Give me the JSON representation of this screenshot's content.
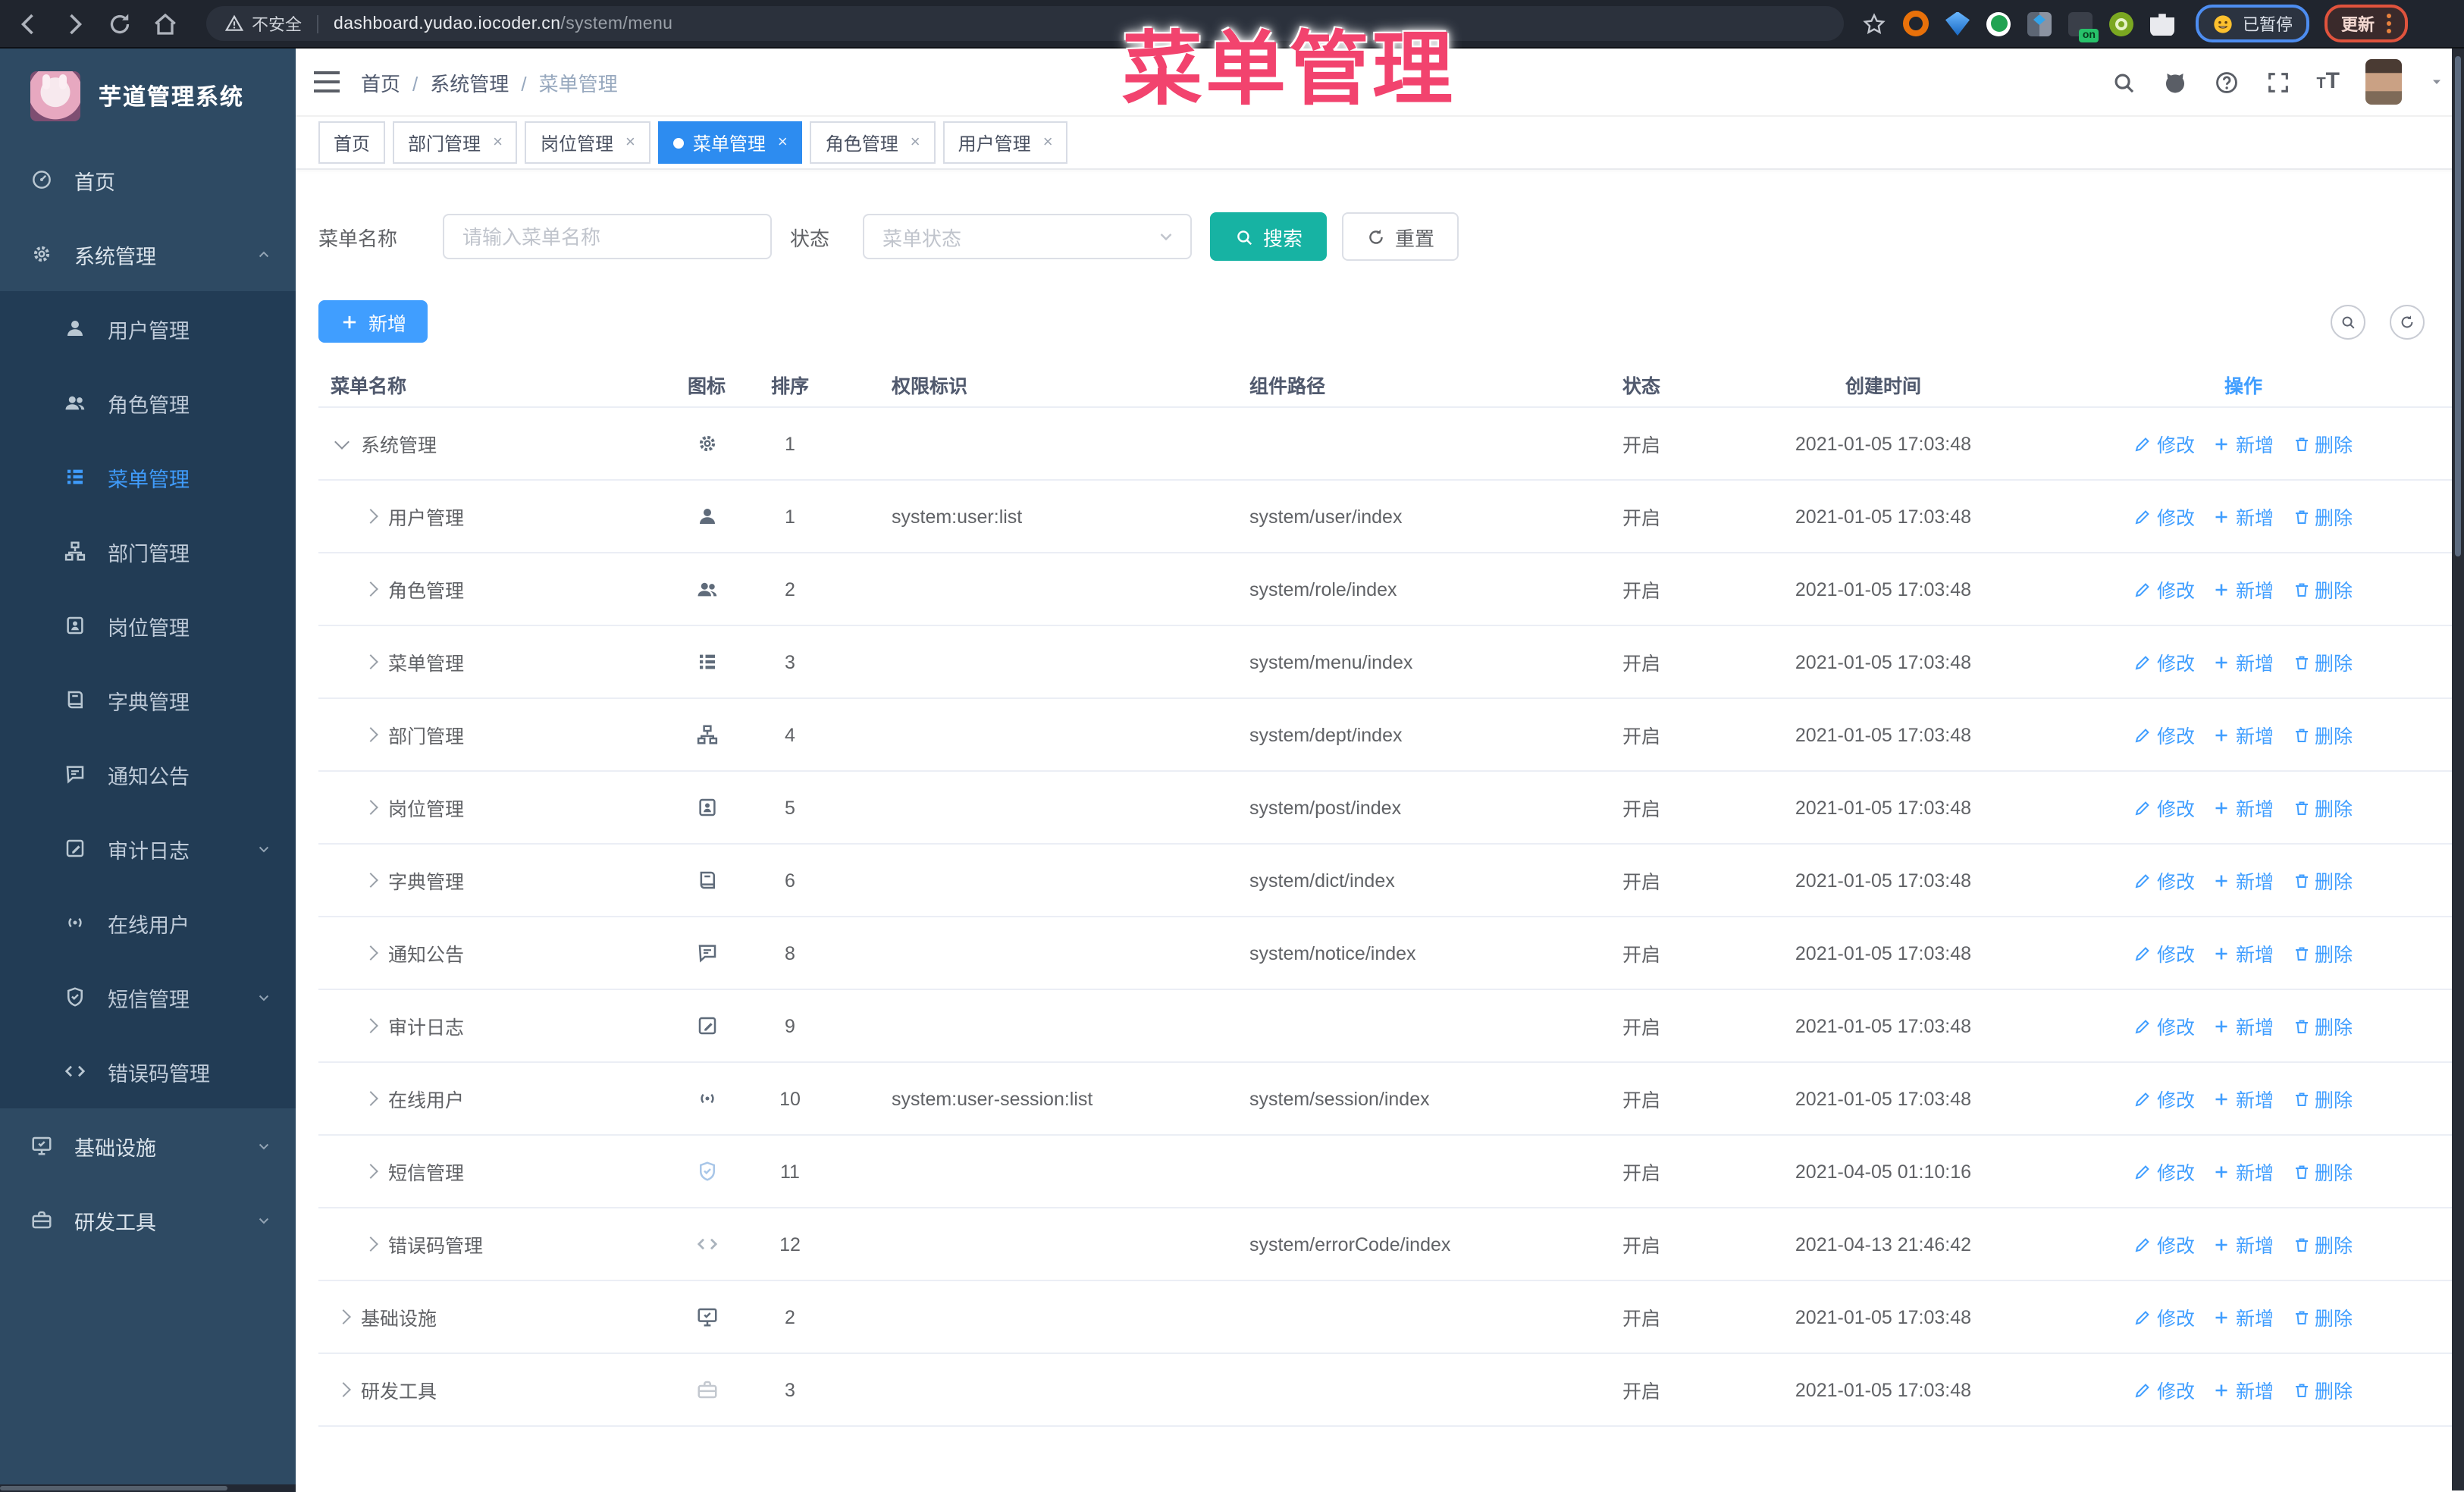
{
  "overlay": {
    "watermark": "菜单管理"
  },
  "browser": {
    "security_label": "不安全",
    "url_host": "dashboard.yudao.iocoder.cn",
    "url_path": "/system/menu",
    "extension_switch": "on",
    "paused_badge": "已暂停",
    "update_button": "更新"
  },
  "sidebar": {
    "app_title": "芋道管理系统",
    "items": [
      {
        "label": "首页",
        "icon": "home-icon",
        "level": 0
      },
      {
        "label": "系统管理",
        "icon": "gear-icon",
        "level": 0,
        "state": "expanded"
      },
      {
        "label": "用户管理",
        "icon": "user-icon",
        "level": 1
      },
      {
        "label": "角色管理",
        "icon": "users-icon",
        "level": 1
      },
      {
        "label": "菜单管理",
        "icon": "menu-icon",
        "level": 1,
        "active": true
      },
      {
        "label": "部门管理",
        "icon": "tree-icon",
        "level": 1
      },
      {
        "label": "岗位管理",
        "icon": "badge-icon",
        "level": 1
      },
      {
        "label": "字典管理",
        "icon": "book-icon",
        "level": 1
      },
      {
        "label": "通知公告",
        "icon": "message-icon",
        "level": 1
      },
      {
        "label": "审计日志",
        "icon": "editlog-icon",
        "level": 1,
        "state": "collapsed"
      },
      {
        "label": "在线用户",
        "icon": "online-icon",
        "level": 1
      },
      {
        "label": "短信管理",
        "icon": "shield-icon",
        "level": 1,
        "state": "collapsed"
      },
      {
        "label": "错误码管理",
        "icon": "code-icon",
        "level": 1
      },
      {
        "label": "基础设施",
        "icon": "monitor-icon",
        "level": 0,
        "state": "collapsed"
      },
      {
        "label": "研发工具",
        "icon": "toolbox-icon",
        "level": 0,
        "state": "collapsed"
      }
    ]
  },
  "header": {
    "breadcrumb": [
      "首页",
      "系统管理",
      "菜单管理"
    ]
  },
  "tabs": [
    {
      "label": "首页",
      "closable": false,
      "active": false
    },
    {
      "label": "部门管理",
      "closable": true,
      "active": false
    },
    {
      "label": "岗位管理",
      "closable": true,
      "active": false
    },
    {
      "label": "菜单管理",
      "closable": true,
      "active": true
    },
    {
      "label": "角色管理",
      "closable": true,
      "active": false
    },
    {
      "label": "用户管理",
      "closable": true,
      "active": false
    }
  ],
  "filters": {
    "name_label": "菜单名称",
    "name_placeholder": "请输入菜单名称",
    "status_label": "状态",
    "status_placeholder": "菜单状态",
    "search_label": "搜索",
    "reset_label": "重置"
  },
  "toolbar": {
    "add_label": "新增"
  },
  "table": {
    "headers": [
      "菜单名称",
      "图标",
      "排序",
      "权限标识",
      "组件路径",
      "状态",
      "创建时间",
      "操作"
    ],
    "actions": {
      "edit": "修改",
      "add": "新增",
      "del": "删除"
    },
    "rows": [
      {
        "name": "系统管理",
        "icon": "gear-icon",
        "level": 0,
        "expanded": true,
        "sort": "1",
        "perm": "",
        "path": "",
        "status": "开启",
        "time": "2021-01-05 17:03:48"
      },
      {
        "name": "用户管理",
        "icon": "user-icon",
        "level": 1,
        "expanded": false,
        "sort": "1",
        "perm": "system:user:list",
        "path": "system/user/index",
        "status": "开启",
        "time": "2021-01-05 17:03:48"
      },
      {
        "name": "角色管理",
        "icon": "users-icon",
        "level": 1,
        "expanded": false,
        "sort": "2",
        "perm": "",
        "path": "system/role/index",
        "status": "开启",
        "time": "2021-01-05 17:03:48"
      },
      {
        "name": "菜单管理",
        "icon": "menu-icon",
        "level": 1,
        "expanded": false,
        "sort": "3",
        "perm": "",
        "path": "system/menu/index",
        "status": "开启",
        "time": "2021-01-05 17:03:48"
      },
      {
        "name": "部门管理",
        "icon": "tree-icon",
        "level": 1,
        "expanded": false,
        "sort": "4",
        "perm": "",
        "path": "system/dept/index",
        "status": "开启",
        "time": "2021-01-05 17:03:48"
      },
      {
        "name": "岗位管理",
        "icon": "badge-icon",
        "level": 1,
        "expanded": false,
        "sort": "5",
        "perm": "",
        "path": "system/post/index",
        "status": "开启",
        "time": "2021-01-05 17:03:48"
      },
      {
        "name": "字典管理",
        "icon": "book-icon",
        "level": 1,
        "expanded": false,
        "sort": "6",
        "perm": "",
        "path": "system/dict/index",
        "status": "开启",
        "time": "2021-01-05 17:03:48"
      },
      {
        "name": "通知公告",
        "icon": "message-icon",
        "level": 1,
        "expanded": false,
        "sort": "8",
        "perm": "",
        "path": "system/notice/index",
        "status": "开启",
        "time": "2021-01-05 17:03:48"
      },
      {
        "name": "审计日志",
        "icon": "editlog-icon",
        "level": 1,
        "expanded": false,
        "sort": "9",
        "perm": "",
        "path": "",
        "status": "开启",
        "time": "2021-01-05 17:03:48"
      },
      {
        "name": "在线用户",
        "icon": "online-icon",
        "level": 1,
        "expanded": false,
        "sort": "10",
        "perm": "system:user-session:list",
        "path": "system/session/index",
        "status": "开启",
        "time": "2021-01-05 17:03:48"
      },
      {
        "name": "短信管理",
        "icon": "shield-icon",
        "level": 1,
        "expanded": false,
        "sort": "11",
        "perm": "",
        "path": "",
        "status": "开启",
        "time": "2021-04-05 01:10:16"
      },
      {
        "name": "错误码管理",
        "icon": "code-icon",
        "level": 1,
        "expanded": false,
        "sort": "12",
        "perm": "",
        "path": "system/errorCode/index",
        "status": "开启",
        "time": "2021-04-13 21:46:42"
      },
      {
        "name": "基础设施",
        "icon": "monitor-icon",
        "level": 0,
        "expanded": false,
        "sort": "2",
        "perm": "",
        "path": "",
        "status": "开启",
        "time": "2021-01-05 17:03:48"
      },
      {
        "name": "研发工具",
        "icon": "toolbox-icon",
        "level": 0,
        "expanded": false,
        "sort": "3",
        "perm": "",
        "path": "",
        "status": "开启",
        "time": "2021-01-05 17:03:48"
      }
    ]
  }
}
